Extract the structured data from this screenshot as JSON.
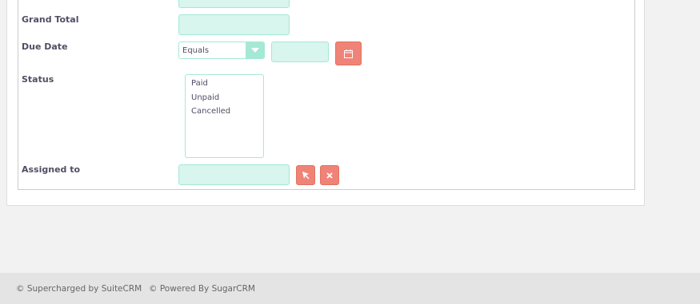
{
  "form": {
    "grand_total": {
      "label": "Grand Total",
      "value": ""
    },
    "due_date": {
      "label": "Due Date",
      "operator_selected": "Equals",
      "value": ""
    },
    "status": {
      "label": "Status",
      "options": [
        "Paid",
        "Unpaid",
        "Cancelled"
      ]
    },
    "assigned_to": {
      "label": "Assigned to",
      "value": ""
    }
  },
  "footer": {
    "supercharged": "© Supercharged by SuiteCRM",
    "powered": "© Powered By SugarCRM"
  },
  "colors": {
    "input_bg": "#d8f5ee",
    "input_border": "#a5e8d6",
    "button_red": "#f08377",
    "label_text": "#534d64"
  },
  "icons": {
    "calendar": "calendar-icon",
    "select": "cursor-select-icon",
    "clear": "close-icon"
  }
}
